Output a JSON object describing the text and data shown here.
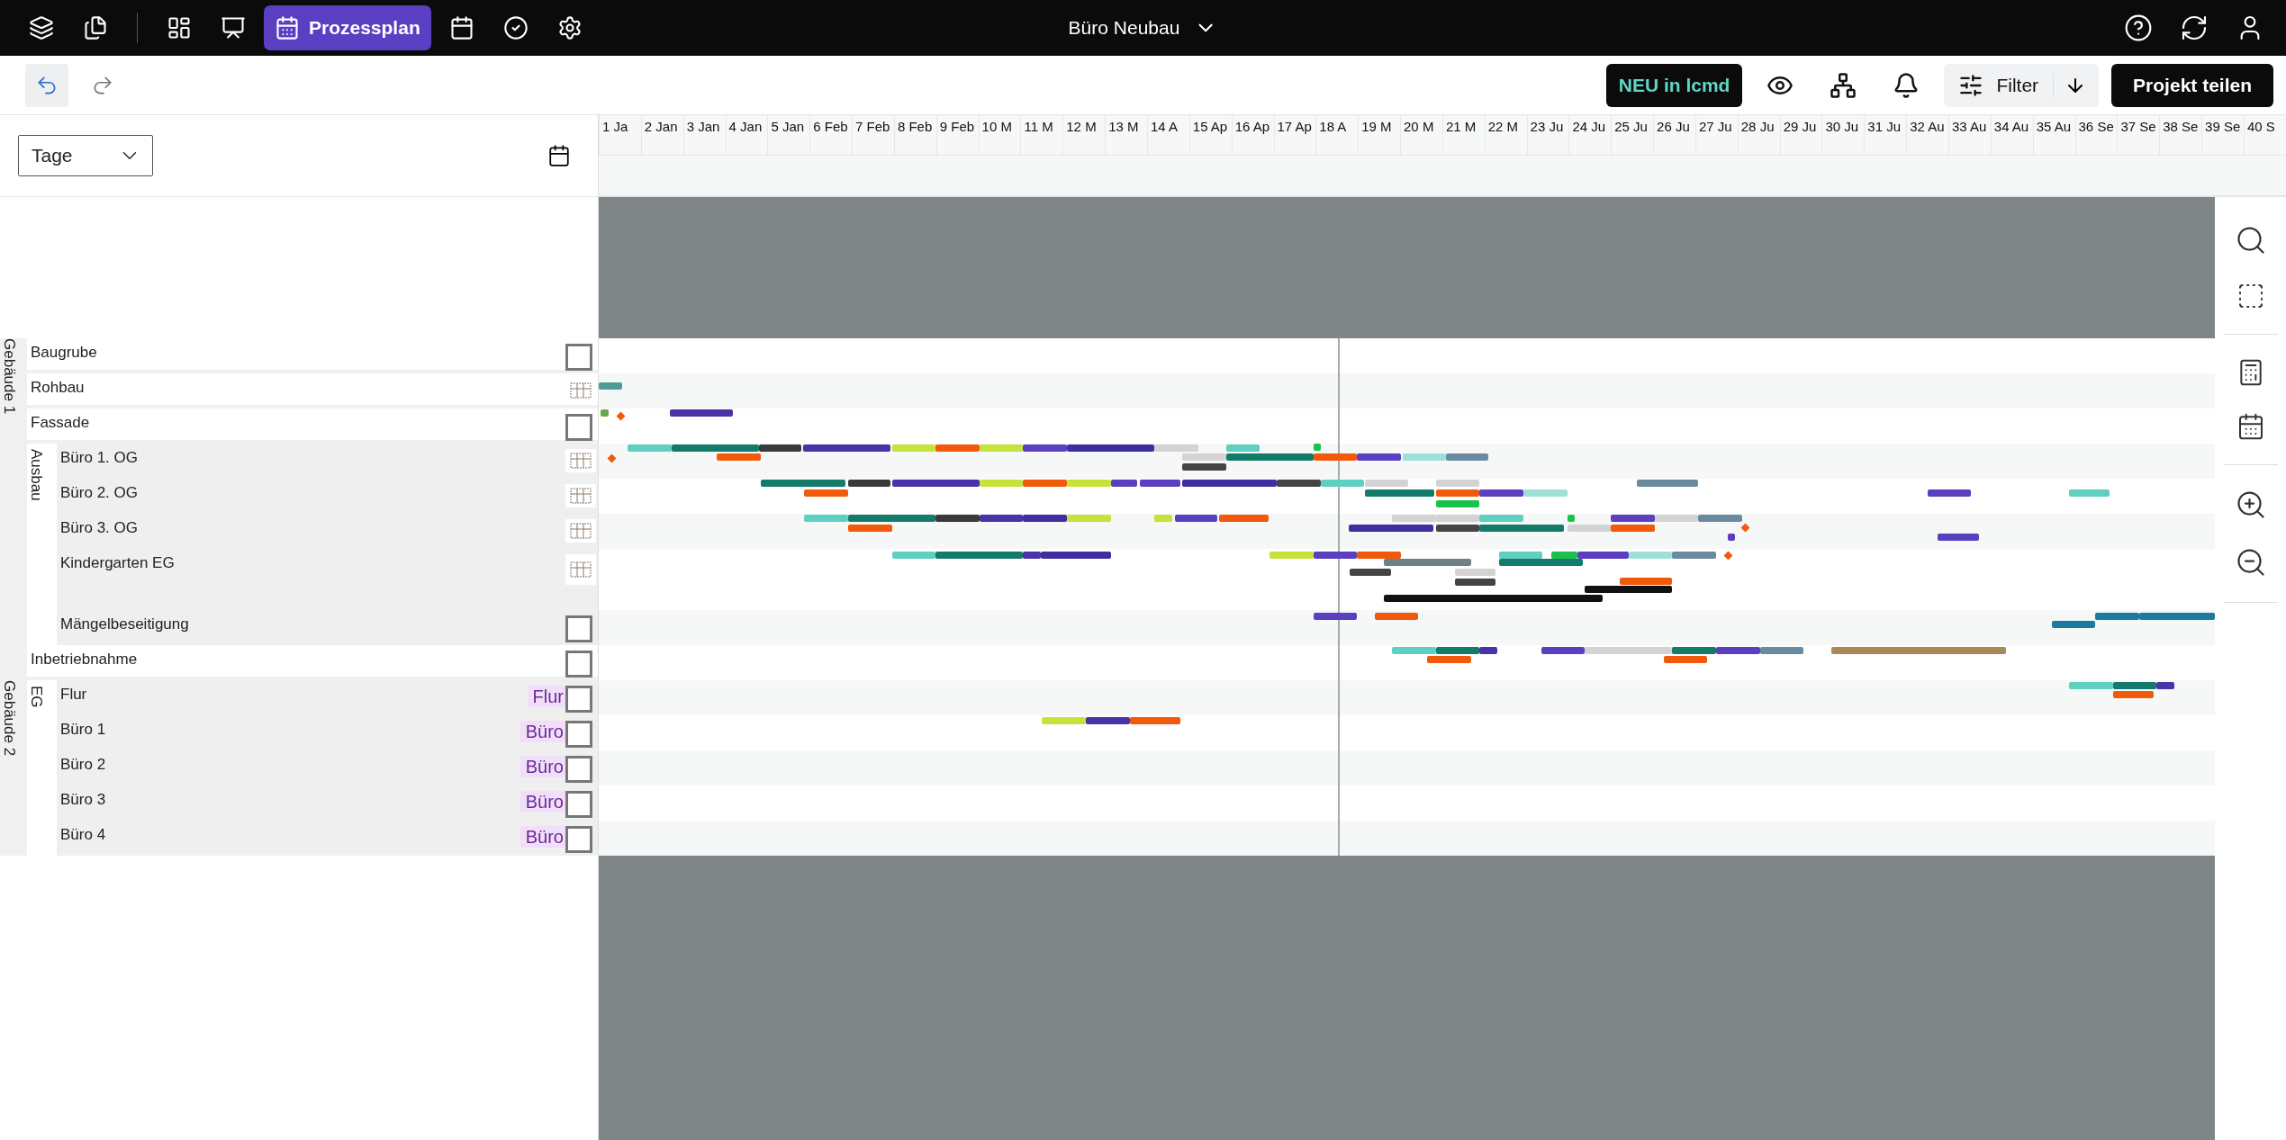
{
  "topbar": {
    "tabs": [
      {
        "selected": false
      },
      {
        "selected": false
      },
      {
        "selected": false
      },
      {
        "selected": false
      },
      {
        "label": "Prozessplan",
        "selected": true
      },
      {
        "selected": false
      },
      {
        "selected": false
      },
      {
        "selected": false
      }
    ],
    "project": "Büro Neubau"
  },
  "toolbar": {
    "news": "NEU in lcmd",
    "filter": "Filter",
    "share": "Projekt teilen"
  },
  "scale": {
    "value": "Tage"
  },
  "weeks": [
    "1 Ja",
    "2 Jan",
    "3 Jan",
    "4 Jan",
    "5 Jan",
    "6 Feb",
    "7 Feb",
    "8 Feb",
    "9 Feb",
    "10 M",
    "11 M",
    "12 M",
    "13 M",
    "14 A",
    "15 Ap",
    "16 Ap",
    "17 Ap",
    "18 A",
    "19 M",
    "20 M",
    "21 M",
    "22 M",
    "23 Ju",
    "24 Ju",
    "25 Ju",
    "26 Ju",
    "27 Ju",
    "28 Ju",
    "29 Ju",
    "30 Ju",
    "31 Ju",
    "32 Au",
    "33 Au",
    "34 Au",
    "35 Au",
    "36 Se",
    "37 Se",
    "38 Se",
    "39 Se",
    "40 S"
  ],
  "tree": [
    {
      "label": "Gebäude 1",
      "children": [
        {
          "label": "Baugrube",
          "kind": "checkbox",
          "checked": false
        },
        {
          "label": "Rohbau",
          "kind": "plan"
        },
        {
          "label": "Fassade",
          "kind": "checkbox",
          "checked": false
        },
        {
          "label": "Ausbau",
          "children": [
            {
              "label": "Büro 1. OG",
              "kind": "plan"
            },
            {
              "label": "Büro 2. OG",
              "kind": "plan"
            },
            {
              "label": "Büro 3. OG",
              "kind": "plan"
            },
            {
              "label": "Kindergarten EG",
              "kind": "plan"
            },
            {
              "label": "Mängelbeseitigung",
              "kind": "checkbox",
              "checked": false
            }
          ]
        },
        {
          "label": "Inbetriebnahme",
          "kind": "checkbox",
          "checked": false
        }
      ]
    },
    {
      "label": "Gebäude 2",
      "children": [
        {
          "label": "EG",
          "children": [
            {
              "label": "Flur",
              "tag": "Flur",
              "kind": "checkbox",
              "checked": false
            },
            {
              "label": "Büro 1",
              "tag": "Büro",
              "kind": "checkbox",
              "checked": false
            },
            {
              "label": "Büro 2",
              "tag": "Büro",
              "kind": "checkbox",
              "checked": false
            },
            {
              "label": "Büro 3",
              "tag": "Büro",
              "kind": "checkbox",
              "checked": false
            },
            {
              "label": "Büro 4",
              "tag": "Büro",
              "kind": "checkbox",
              "checked": false
            }
          ]
        }
      ]
    }
  ]
}
